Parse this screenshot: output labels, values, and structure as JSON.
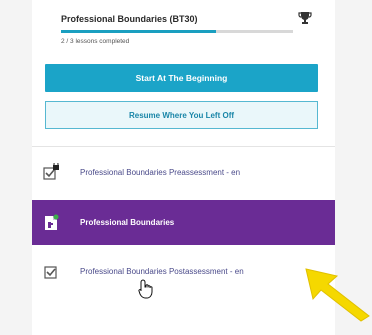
{
  "course": {
    "title": "Professional Boundaries (BT30)",
    "lessons_completed": "2 / 3 lessons completed",
    "progress_fraction": 0.67
  },
  "actions": {
    "start_label": "Start At The Beginning",
    "resume_label": "Resume Where You Left Off"
  },
  "lessons": [
    {
      "label": "Professional Boundaries Preassessment - en",
      "icon": "checkbox-lock-icon",
      "state": "completed"
    },
    {
      "label": "Professional Boundaries",
      "icon": "document-icon",
      "state": "current"
    },
    {
      "label": "Professional Boundaries Postassessment - en",
      "icon": "checkbox-icon",
      "state": "completed"
    }
  ],
  "colors": {
    "accent": "#1ba4c8",
    "current_row": "#6a2c95",
    "pointer_arrow": "#f5d800"
  }
}
